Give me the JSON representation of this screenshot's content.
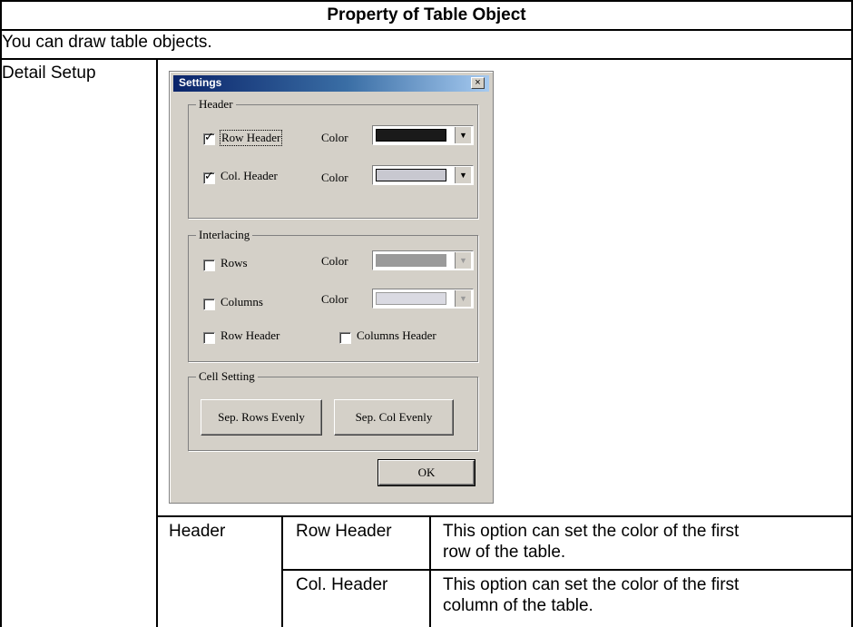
{
  "title": "Property of Table Object",
  "intro": "You can draw table objects.",
  "detail_label": "Detail Setup",
  "dialog": {
    "title": "Settings",
    "close_glyph": "×",
    "header_group": {
      "label": "Header",
      "row_header": {
        "label": "Row Header",
        "checked": true,
        "color_label": "Color",
        "color": "#1a1a1a"
      },
      "col_header": {
        "label": "Col. Header",
        "checked": true,
        "color_label": "Color",
        "color": "#c8c8d0"
      }
    },
    "interlacing_group": {
      "label": "Interlacing",
      "rows": {
        "label": "Rows",
        "checked": false,
        "color_label": "Color",
        "color": "#9a9a9a"
      },
      "columns": {
        "label": "Columns",
        "checked": false,
        "color_label": "Color",
        "color": "#dadae2"
      },
      "row_header": {
        "label": "Row Header",
        "checked": false
      },
      "columns_header": {
        "label": "Columns Header",
        "checked": false
      }
    },
    "cell_group": {
      "label": "Cell Setting",
      "sep_rows": "Sep. Rows Evenly",
      "sep_cols": "Sep. Col Evenly"
    },
    "ok": "OK",
    "check_glyph": "✓",
    "arrow_glyph": "▼"
  },
  "lower_table": {
    "group": "Header",
    "rows": [
      {
        "item": "Row Header",
        "desc_line1": "This option can set the color of the first",
        "desc_line2": "row of the table."
      },
      {
        "item": "Col. Header",
        "desc_line1": "This option can set the color of the first",
        "desc_line2": "column of the table."
      }
    ]
  }
}
